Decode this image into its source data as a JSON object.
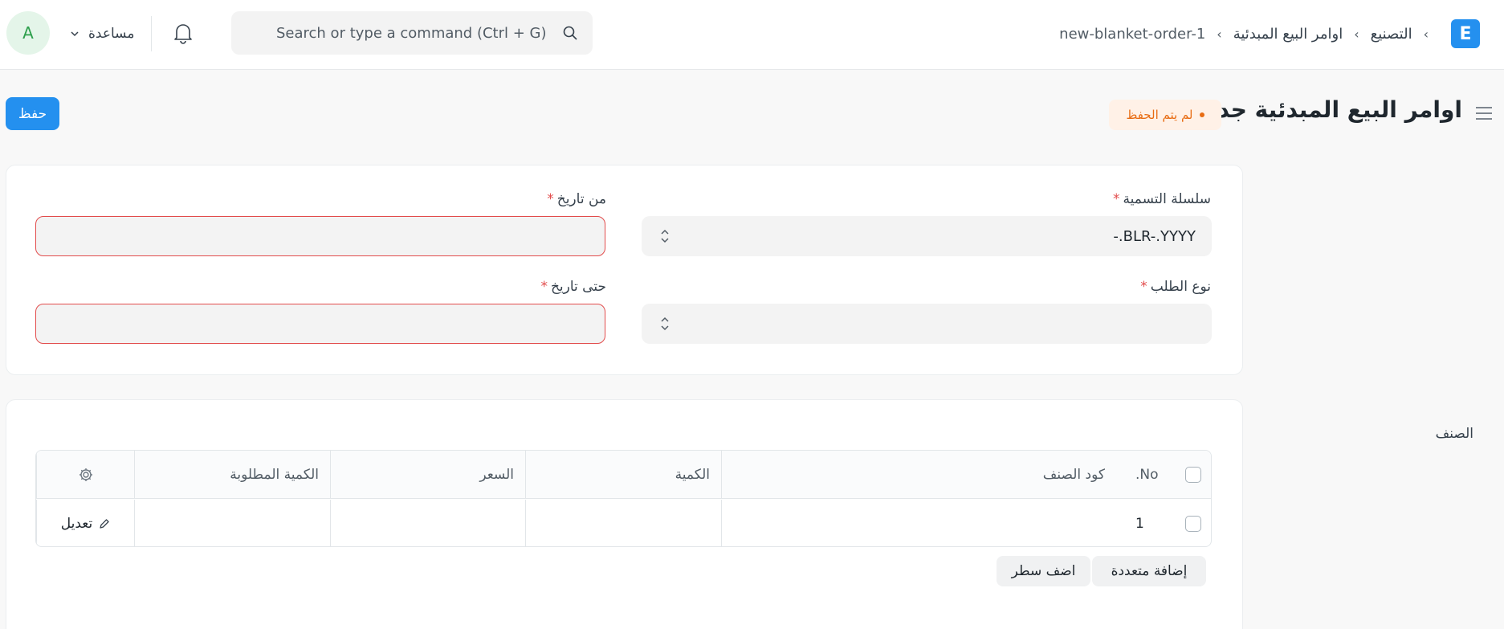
{
  "navbar": {
    "avatar_letter": "A",
    "help_label": "مساعدة",
    "search_placeholder": "Search or type a command (Ctrl + G)",
    "logo_letter": "E",
    "breadcrumbs": [
      "التصنيع",
      "اوامر البيع المبدئية",
      "new-blanket-order-1"
    ]
  },
  "page": {
    "title": "اوامر البيع المبدئية جديد",
    "status": "لم يتم الحفظ",
    "save_label": "حفظ"
  },
  "form": {
    "naming_series": {
      "label": "سلسلة التسمية",
      "value": "-.BLR-.YYYY"
    },
    "from_date": {
      "label": "من تاريخ",
      "value": ""
    },
    "order_type": {
      "label": "نوع الطلب",
      "value": ""
    },
    "to_date": {
      "label": "حتى تاريخ",
      "value": ""
    },
    "required_marker": "*"
  },
  "items_table": {
    "title": "الصنف",
    "columns": [
      "No.",
      "كود الصنف",
      "الكمية",
      "السعر",
      "الكمية المطلوبة"
    ],
    "rows": [
      {
        "no": "1",
        "item_code": "",
        "qty": "",
        "rate": "",
        "ordered_qty": "",
        "edit_label": "تعديل"
      }
    ],
    "add_multiple_label": "إضافة متعددة",
    "add_row_label": "اضف سطر"
  },
  "colors": {
    "primary": "#2490ef",
    "status": "#e86c13",
    "required": "#e24c4c"
  },
  "icons": [
    "bell-icon",
    "search-icon",
    "chevron-down-icon",
    "menu-icon",
    "gear-icon",
    "pencil-icon",
    "updown-icon"
  ]
}
